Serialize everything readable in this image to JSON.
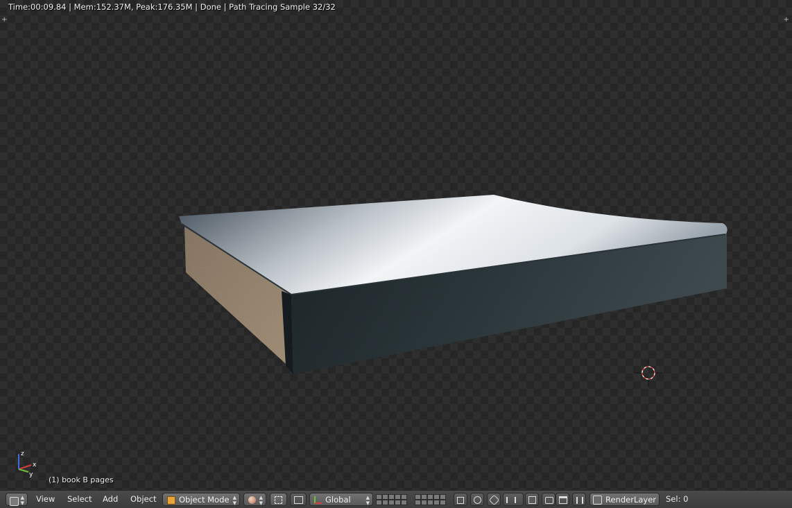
{
  "render_stats": {
    "text": "Time:00:09.84 | Mem:152.37M, Peak:176.35M | Done | Path Tracing Sample 32/32"
  },
  "viewport": {
    "object_label": "(1) book B pages",
    "axis_labels": {
      "x": "x",
      "y": "y",
      "z": "z"
    }
  },
  "header": {
    "menus": {
      "view": "View",
      "select": "Select",
      "add": "Add",
      "object": "Object"
    },
    "mode": "Object Mode",
    "orientation": "Global",
    "render_layer": "RenderLayer",
    "selection": "Sel: 0"
  },
  "colors": {
    "accent_orange": "#e8a33a",
    "crosshair_red": "#d9463a",
    "axis_x": "#d83b3b",
    "axis_y": "#6fbf3b",
    "axis_z": "#3b6cd8"
  },
  "icons": [
    "editor-type-icon",
    "object-mode-icon",
    "viewport-shading-icon",
    "pivot-icon",
    "manipulator-icon",
    "orientation-icon",
    "render-camera-icon",
    "snap-icon",
    "proportional-icon",
    "render-layer-icon"
  ]
}
